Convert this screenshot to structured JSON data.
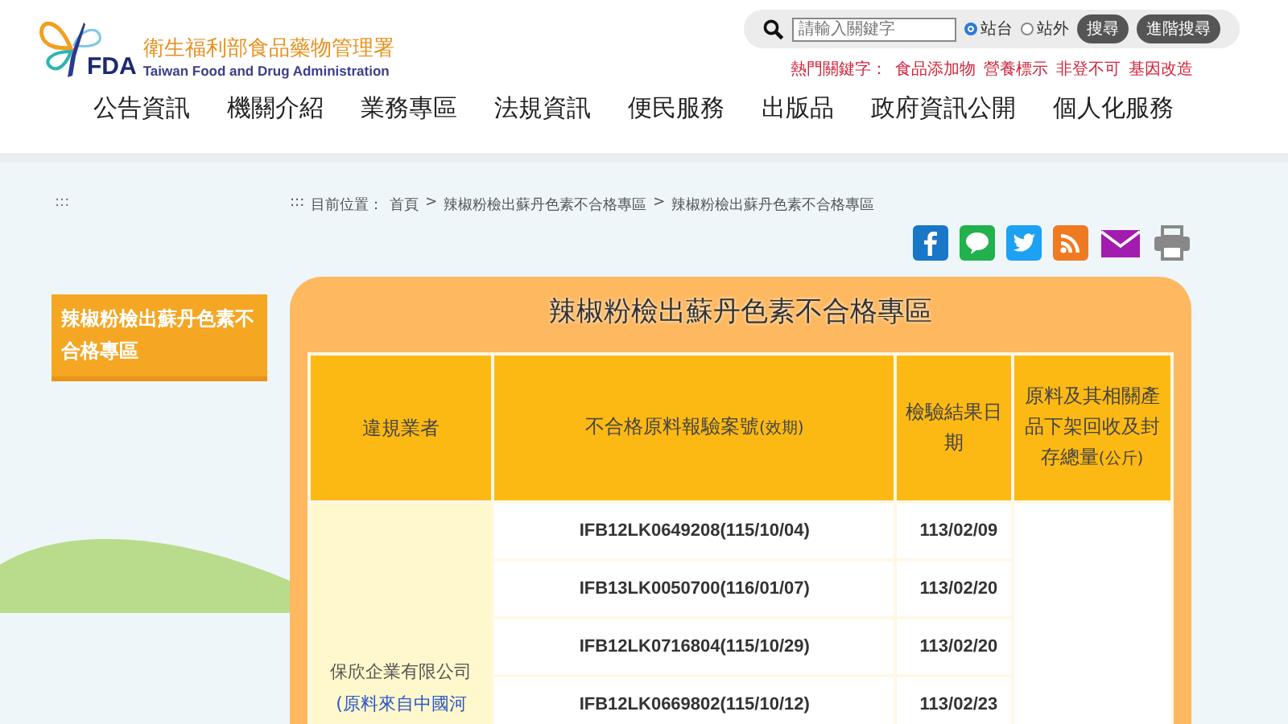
{
  "logo": {
    "mark": "FDA",
    "name_zh": "衛生福利部食品藥物管理署",
    "name_en": "Taiwan Food and Drug Administration"
  },
  "search": {
    "placeholder": "請輸入關鍵字",
    "scopes": [
      {
        "label": "站台",
        "selected": true
      },
      {
        "label": "站外",
        "selected": false
      }
    ],
    "buttons": [
      "搜尋",
      "進階搜尋"
    ]
  },
  "hot_keywords": {
    "label": "熱門關鍵字：",
    "items": [
      "食品添加物",
      "營養標示",
      "非登不可",
      "基因改造"
    ]
  },
  "nav": [
    "公告資訊",
    "機關介紹",
    "業務專區",
    "法規資訊",
    "便民服務",
    "出版品",
    "政府資訊公開",
    "個人化服務"
  ],
  "left_marker": ":::",
  "sidebar": {
    "items": [
      {
        "label": "辣椒粉檢出蘇丹色素不合格專區",
        "selected": true
      }
    ]
  },
  "breadcrumb": {
    "marker": ":::",
    "label": "目前位置：",
    "items": [
      "首頁",
      "辣椒粉檢出蘇丹色素不合格專區",
      "辣椒粉檢出蘇丹色素不合格專區"
    ],
    "separator": ">"
  },
  "panel": {
    "title": "辣椒粉檢出蘇丹色素不合格專區"
  },
  "table": {
    "columns": [
      {
        "label": "違規業者"
      },
      {
        "label": "不合格原料報驗案號",
        "note": "(效期)"
      },
      {
        "label": "檢驗結果日期"
      },
      {
        "label": "原料及其相關產品下架回收及封存總量",
        "note": "(公斤)"
      }
    ],
    "company": {
      "name": "保欣企業有限公司",
      "link": "(原料來自中國河"
    },
    "rows": [
      {
        "case": "IFB12LK0649208(115/10/04)",
        "date": "113/02/09"
      },
      {
        "case": "IFB13LK0050700(116/01/07)",
        "date": "113/02/20"
      },
      {
        "case": "IFB12LK0716804(115/10/29)",
        "date": "113/02/20"
      },
      {
        "case": "IFB12LK0669802(115/10/12)",
        "date": "113/02/23"
      }
    ]
  }
}
